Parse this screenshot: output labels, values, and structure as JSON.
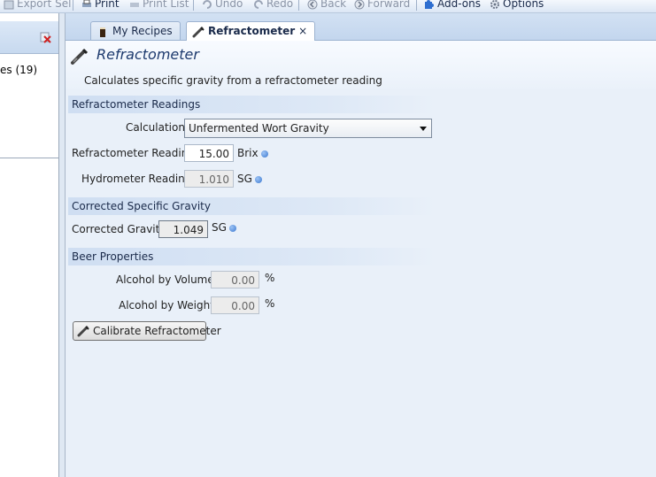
{
  "toolbar": {
    "items": [
      {
        "label": "Export Sel",
        "icon": "export-icon",
        "enabled": false
      },
      {
        "label": "Print",
        "icon": "print-icon",
        "enabled": true
      },
      {
        "label": "Print List",
        "icon": "print-list-icon",
        "enabled": false
      },
      {
        "label": "Undo",
        "icon": "undo-icon",
        "enabled": false
      },
      {
        "label": "Redo",
        "icon": "redo-icon",
        "enabled": false
      },
      {
        "label": "Back",
        "icon": "back-icon",
        "enabled": false
      },
      {
        "label": "Forward",
        "icon": "forward-icon",
        "enabled": false
      },
      {
        "label": "Add-ons",
        "icon": "puzzle-icon",
        "enabled": true
      },
      {
        "label": "Options",
        "icon": "gear-icon",
        "enabled": true
      }
    ]
  },
  "left_pane": {
    "item_label": "es (19)"
  },
  "tabs": [
    {
      "label": "My Recipes",
      "icon": "beer-glass-icon",
      "active": false
    },
    {
      "label": "Refractometer",
      "icon": "refractometer-icon",
      "active": true,
      "close": "×"
    }
  ],
  "header": {
    "title": "Refractometer",
    "description": "Calculates specific gravity from a refractometer reading"
  },
  "sections": {
    "readings": "Refractometer Readings",
    "corrected": "Corrected Specific Gravity",
    "beer": "Beer Properties"
  },
  "fields": {
    "calculation_label": "Calculation",
    "calculation_value": "Unfermented Wort Gravity",
    "refractometer_label": "Refractometer Reading",
    "refractometer_value": "15.00",
    "refractometer_unit": "Brix",
    "hydrometer_label": "Hydrometer Reading",
    "hydrometer_value": "1.010",
    "hydrometer_unit": "SG",
    "corrected_label": "Corrected Gravity",
    "corrected_value": "1.049",
    "corrected_unit": "SG",
    "abv_label": "Alcohol by Volume",
    "abv_value": "0.00",
    "abv_unit": "%",
    "abw_label": "Alcohol by Weight",
    "abw_value": "0.00",
    "abw_unit": "%"
  },
  "calibrate_button": "Calibrate Refractometer",
  "colors": {
    "accent": "#1d3a6e",
    "info_dot": "#3a78d0",
    "background": "#e9f0f9"
  }
}
